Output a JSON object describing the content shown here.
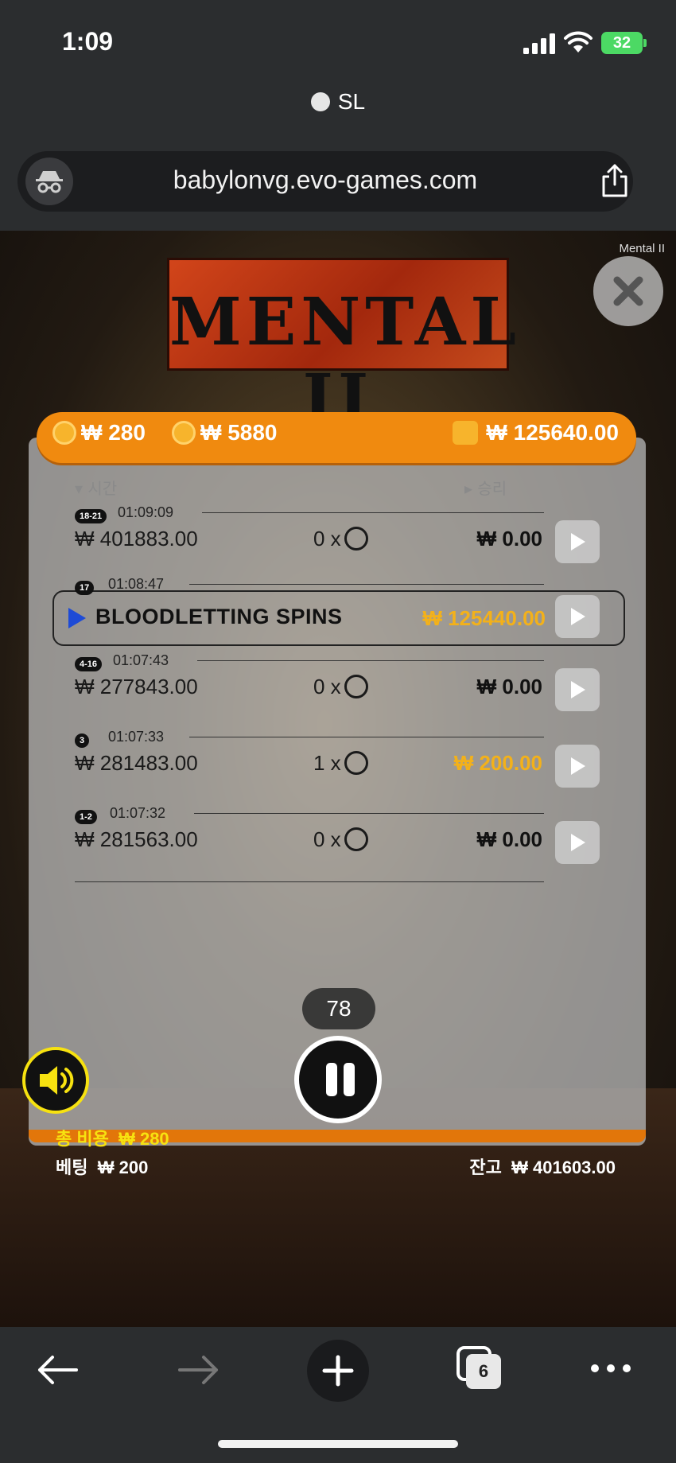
{
  "status_bar": {
    "time": "1:09",
    "battery": "32"
  },
  "browser": {
    "tab_title": "SL",
    "url": "babylonvg.evo-games.com",
    "tabs_count": "6"
  },
  "game": {
    "name_label": "Mental II",
    "logo_text": "MENTAL II",
    "header": {
      "coin_value_1": "₩ 280",
      "coin_value_2": "₩ 5880",
      "wallet_value": "₩ 125640.00"
    },
    "columns": {
      "time": "시간",
      "win": "승리"
    },
    "history": [
      {
        "badge": "18-21",
        "time": "01:09:09",
        "bet": "₩ 401883.00",
        "multiplier": "0 x",
        "win": "₩ 0.00",
        "highlight": false
      },
      {
        "badge": "17",
        "time": "01:08:47",
        "bonus_label": "BLOODLETTING SPINS",
        "win": "₩ 125440.00",
        "highlight": true
      },
      {
        "badge": "4-16",
        "time": "01:07:43",
        "bet": "₩ 277843.00",
        "multiplier": "0 x",
        "win": "₩ 0.00",
        "highlight": false
      },
      {
        "badge": "3",
        "time": "01:07:33",
        "bet": "₩ 281483.00",
        "multiplier": "1 x",
        "win": "₩ 200.00",
        "highlight": true
      },
      {
        "badge": "1-2",
        "time": "01:07:32",
        "bet": "₩ 281563.00",
        "multiplier": "0 x",
        "win": "₩ 0.00",
        "highlight": false
      }
    ],
    "spin_counter": "78",
    "footer": {
      "total_cost_label": "총 비용",
      "total_cost_value": "₩ 280",
      "bet_label": "베팅",
      "bet_value": "₩ 200",
      "balance_label": "잔고",
      "balance_value": "₩ 401603.00"
    }
  },
  "colors": {
    "accent_orange": "#f08a0f",
    "gold": "#f3b11a",
    "sound_yellow": "#f7e210"
  }
}
